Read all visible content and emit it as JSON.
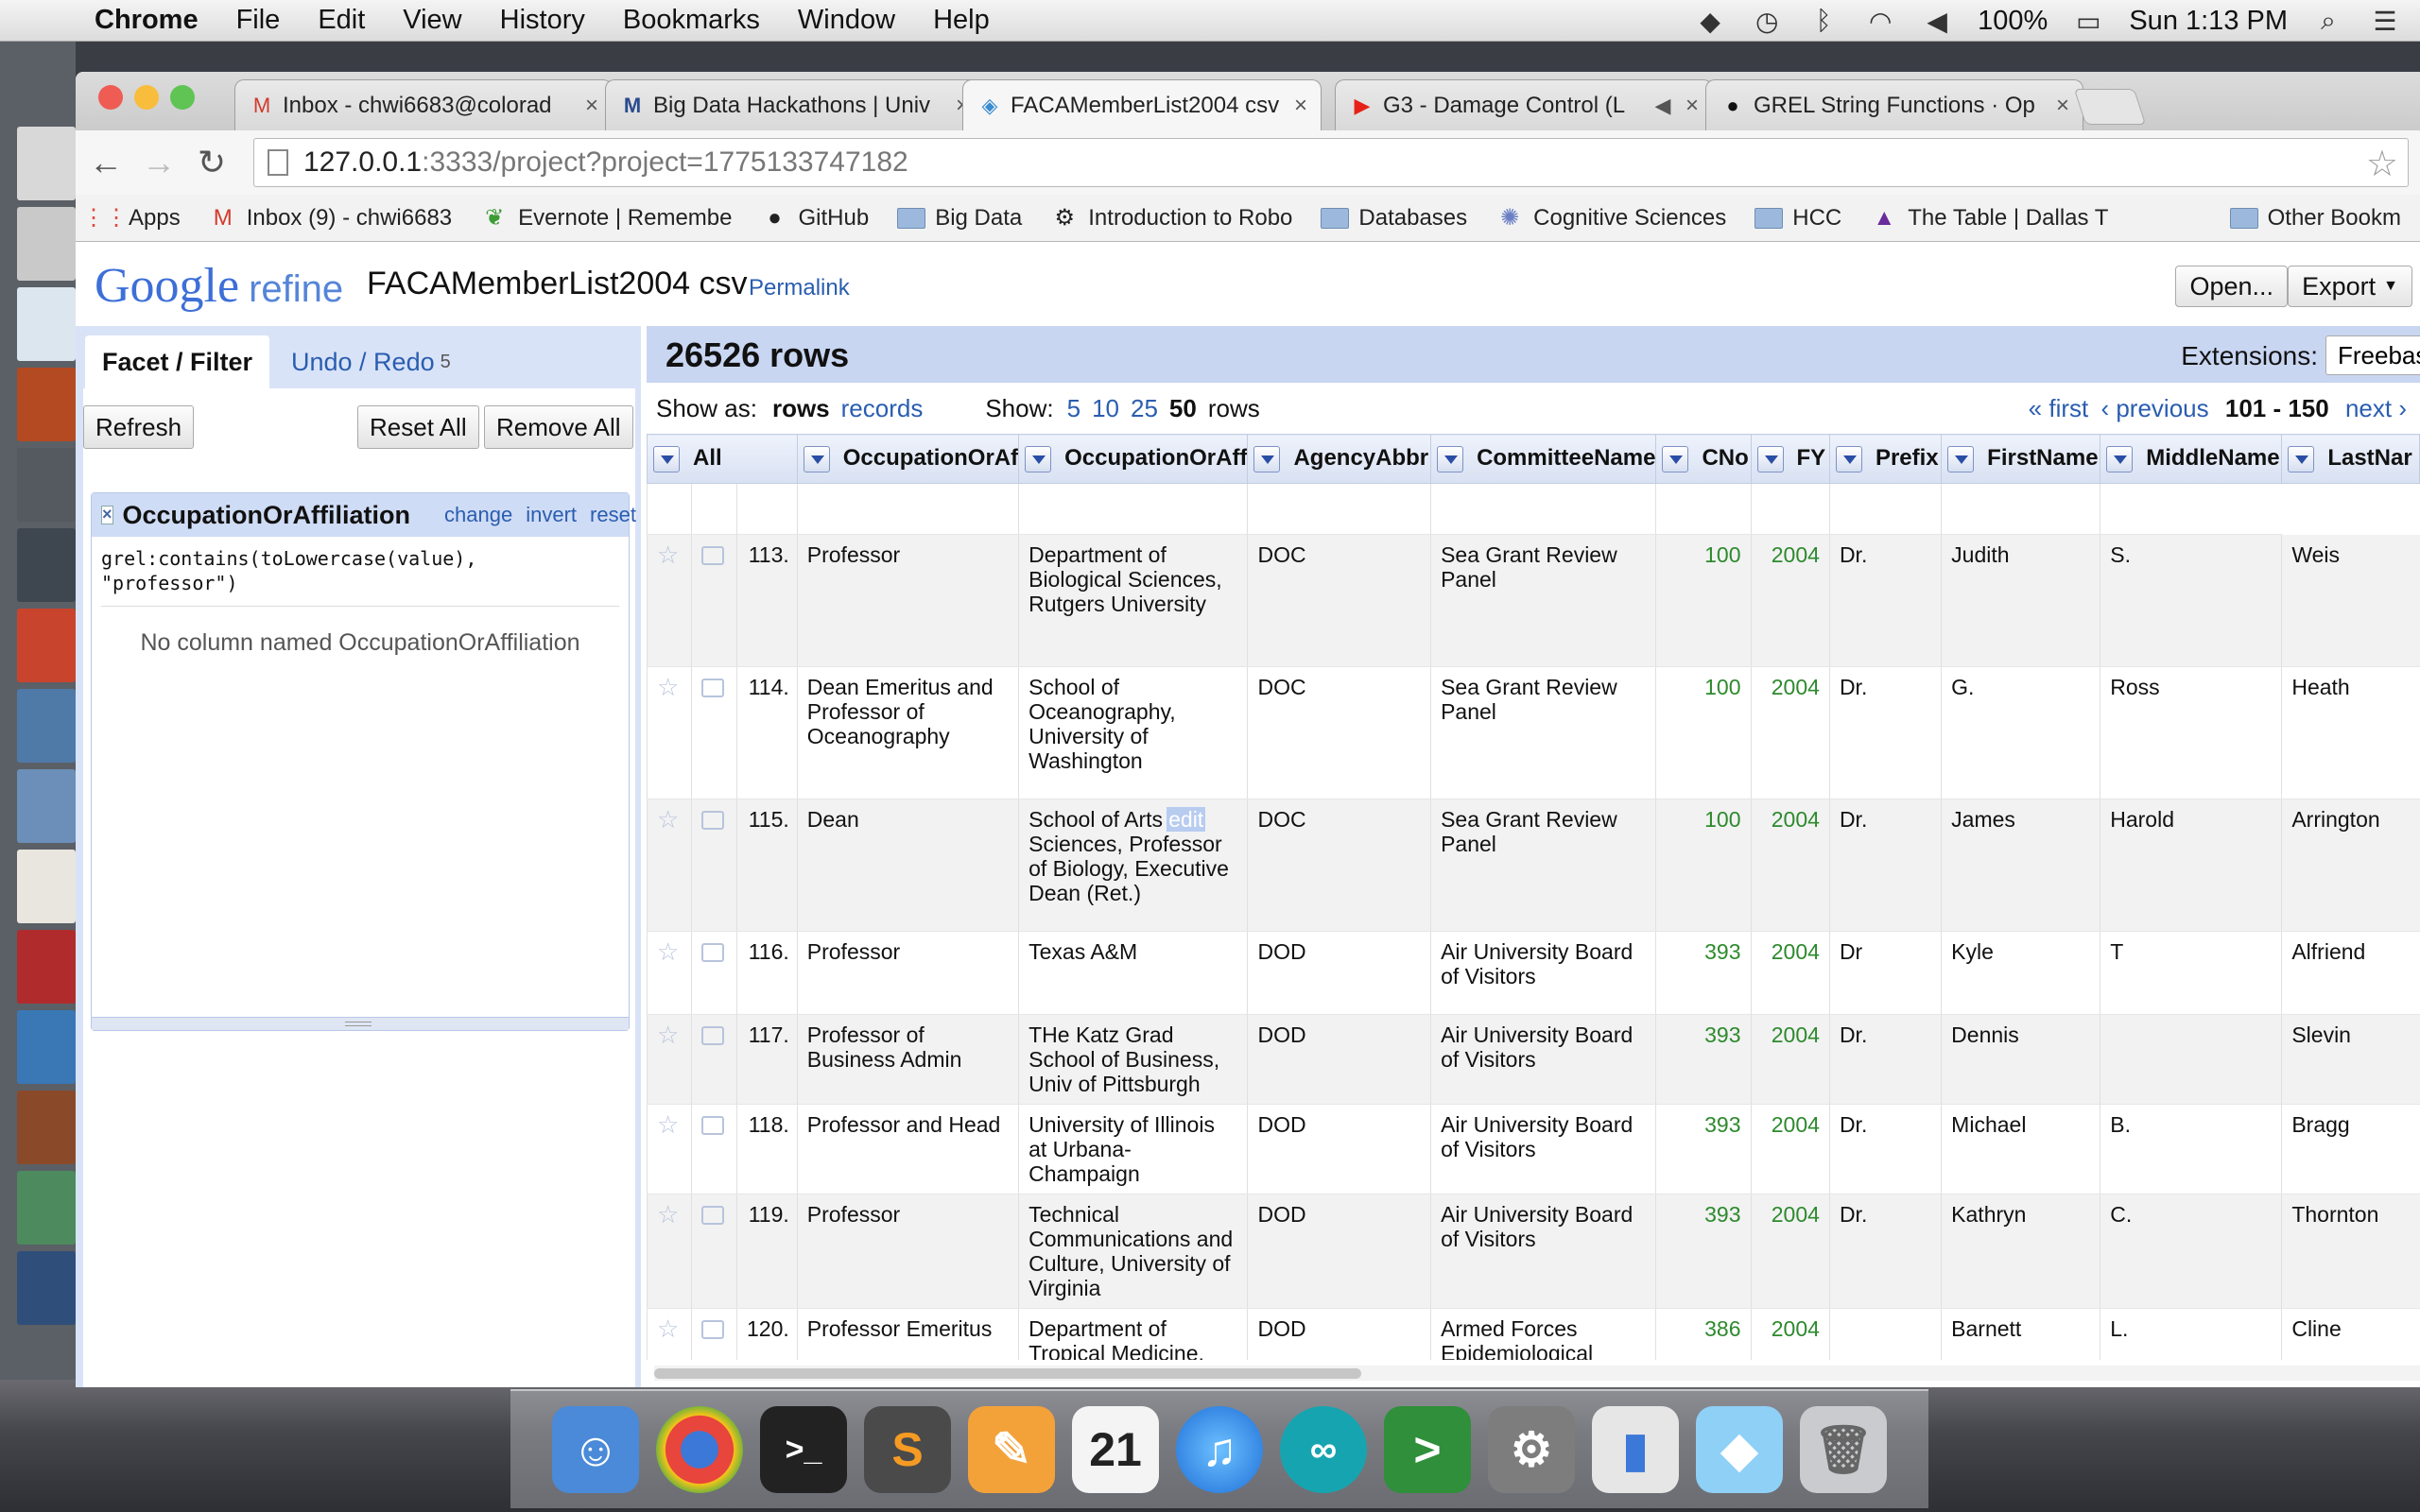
{
  "menubar": {
    "app_name": "Chrome",
    "menus": [
      "File",
      "Edit",
      "View",
      "History",
      "Bookmarks",
      "Window",
      "Help"
    ],
    "battery": "100%",
    "clock": "Sun 1:13 PM"
  },
  "browser": {
    "tabs": [
      {
        "title": "Inbox - chwi6683@colorad",
        "icon": "gmail-icon"
      },
      {
        "title": "Big Data Hackathons | Univ",
        "icon": "m-icon"
      },
      {
        "title": "FACAMemberList2004 csv",
        "icon": "refine-icon"
      },
      {
        "title": "G3 - Damage Control (L",
        "icon": "youtube-icon"
      },
      {
        "title": "GREL String Functions · Op",
        "icon": "github-icon"
      }
    ],
    "url_host": "127.0.0.1",
    "url_path": ":3333/project?project=1775133747182",
    "bookmarks": [
      "Apps",
      "Inbox (9) - chwi6683",
      "Evernote | Remembe",
      "GitHub",
      "Big Data",
      "Introduction to Robo",
      "Databases",
      "Cognitive Sciences",
      "HCC",
      "The Table | Dallas T",
      "Other Bookm"
    ]
  },
  "refine": {
    "logo_google": "Google",
    "logo_refine": "refine",
    "project_name": "FACAMemberList2004 csv",
    "permalink": "Permalink",
    "open_button": "Open...",
    "export_button": "Export",
    "left": {
      "tab_facet": "Facet / Filter",
      "tab_undo": "Undo / Redo",
      "undo_count": "5",
      "refresh": "Refresh",
      "reset_all": "Reset All",
      "remove_all": "Remove All",
      "facet": {
        "title": "OccupationOrAffiliation",
        "change": "change",
        "invert": "invert",
        "reset": "reset",
        "expression_line1": "grel:contains(toLowercase(value),",
        "expression_line2": "\"professor\")",
        "message": "No column named OccupationOrAffiliation"
      }
    },
    "right": {
      "row_count": "26526 rows",
      "extensions_label": "Extensions:",
      "extensions_button": "Freebas",
      "show_as_label": "Show as:",
      "show_as_rows": "rows",
      "show_as_records": "records",
      "show_label": "Show:",
      "page_sizes": [
        "5",
        "10",
        "25",
        "50"
      ],
      "rows_word": "rows",
      "pager_first": "« first",
      "pager_previous": "‹ previous",
      "pager_range": "101 - 150",
      "pager_next": "next ›"
    },
    "columns": [
      "All",
      "OccupationOrAf",
      "OccupationOrAff",
      "AgencyAbbr",
      "CommitteeName",
      "CNo",
      "FY",
      "Prefix",
      "FirstName",
      "MiddleName",
      "LastNar"
    ],
    "rows": [
      {
        "n": "113.",
        "occ": "Professor",
        "aff": "Department of Biological Sciences, Rutgers University",
        "agency": "DOC",
        "committee": "Sea Grant Review Panel",
        "cno": "100",
        "fy": "2004",
        "prefix": "Dr.",
        "first": "Judith",
        "middle": "S.",
        "last": "Weis"
      },
      {
        "n": "114.",
        "occ": "Dean Emeritus and Professor of Oceanography",
        "aff": "School of Oceanography, University of Washington",
        "agency": "DOC",
        "committee": "Sea Grant Review Panel",
        "cno": "100",
        "fy": "2004",
        "prefix": "Dr.",
        "first": "G.",
        "middle": "Ross",
        "last": "Heath"
      },
      {
        "n": "115.",
        "occ": "Dean",
        "aff": "School of Arts & Sciences, Professor of Biology, Executive Dean (Ret.)",
        "aff_edit": "edit",
        "agency": "DOC",
        "committee": "Sea Grant Review Panel",
        "cno": "100",
        "fy": "2004",
        "prefix": "Dr.",
        "first": "James",
        "middle": "Harold",
        "last": "Arrington"
      },
      {
        "n": "116.",
        "occ": "Professor",
        "aff": "Texas A&M",
        "agency": "DOD",
        "committee": "Air University Board of Visitors",
        "cno": "393",
        "fy": "2004",
        "prefix": "Dr",
        "first": "Kyle",
        "middle": "T",
        "last": "Alfriend"
      },
      {
        "n": "117.",
        "occ": "Professor of Business Admin",
        "aff": "THe Katz Grad School of Business, Univ of Pittsburgh",
        "agency": "DOD",
        "committee": "Air University Board of Visitors",
        "cno": "393",
        "fy": "2004",
        "prefix": "Dr.",
        "first": "Dennis",
        "middle": "",
        "last": "Slevin"
      },
      {
        "n": "118.",
        "occ": "Professor and Head",
        "aff": "University of Illinois at Urbana-Champaign",
        "agency": "DOD",
        "committee": "Air University Board of Visitors",
        "cno": "393",
        "fy": "2004",
        "prefix": "Dr.",
        "first": "Michael",
        "middle": "B.",
        "last": "Bragg"
      },
      {
        "n": "119.",
        "occ": "Professor",
        "aff": "Technical Communications and Culture, University of Virginia",
        "agency": "DOD",
        "committee": "Air University Board of Visitors",
        "cno": "393",
        "fy": "2004",
        "prefix": "Dr.",
        "first": "Kathryn",
        "middle": "C.",
        "last": "Thornton"
      },
      {
        "n": "120.",
        "occ": "Professor Emeritus",
        "aff": "Department of Tropical Medicine, Tulane School of",
        "agency": "DOD",
        "committee": "Armed Forces Epidemiological Board",
        "cno": "386",
        "fy": "2004",
        "prefix": "",
        "first": "Barnett",
        "middle": "L.",
        "last": "Cline"
      }
    ]
  }
}
